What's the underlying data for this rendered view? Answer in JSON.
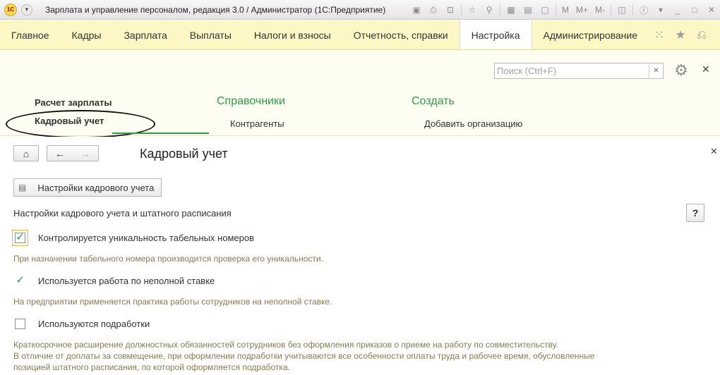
{
  "window": {
    "title": "Зарплата и управление персоналом, редакция 3.0 / Администратор  (1С:Предприятие)",
    "logo_text": "1С",
    "toolbar_text": [
      "M",
      "M+",
      "M-"
    ]
  },
  "sections": [
    {
      "label": "Главное"
    },
    {
      "label": "Кадры"
    },
    {
      "label": "Зарплата"
    },
    {
      "label": "Выплаты"
    },
    {
      "label": "Налоги и взносы"
    },
    {
      "label": "Отчетность, справки"
    },
    {
      "label": "Настройка",
      "active": true
    },
    {
      "label": "Администрирование"
    }
  ],
  "panel": {
    "search_placeholder": "Поиск (Ctrl+F)",
    "column1": {
      "links": [
        "Расчет зарплаты",
        "Кадровый учет"
      ]
    },
    "column2": {
      "heading": "Справочники",
      "links": [
        "Контрагенты"
      ]
    },
    "column3": {
      "heading": "Создать",
      "links": [
        "Добавить организацию"
      ]
    }
  },
  "form": {
    "title": "Кадровый учет",
    "settings_button": "Настройки кадрового учета",
    "section_label": "Настройки кадрового учета и штатного расписания",
    "help_label": "?",
    "options": [
      {
        "label": "Контролируется уникальность табельных номеров",
        "checked": true,
        "hint": [
          "При назначении табельного номера производится проверка его уникальности."
        ]
      },
      {
        "label": "Используется работа по неполной ставке",
        "checked": true,
        "hint": [
          "На предприятии применяется практика работы сотрудников на неполной ставке."
        ]
      },
      {
        "label": "Используются подработки",
        "checked": false,
        "hint": [
          "Краткосрочное расширение должностных обязанностей сотрудников без оформления приказов о приеме на работу по совместительству.",
          "В отличие от доплаты за совмещение, при оформлении подработки учитываются все особенности оплаты труда и рабочее время, обусловленные",
          "позицией штатного расписания, по которой оформляется подработка."
        ]
      }
    ]
  },
  "colors": {
    "menu_bg": "#fcf7c4",
    "panel_bg": "#fefdf2",
    "accent_green": "#2f9a49",
    "hint_text": "#8a7a55"
  }
}
